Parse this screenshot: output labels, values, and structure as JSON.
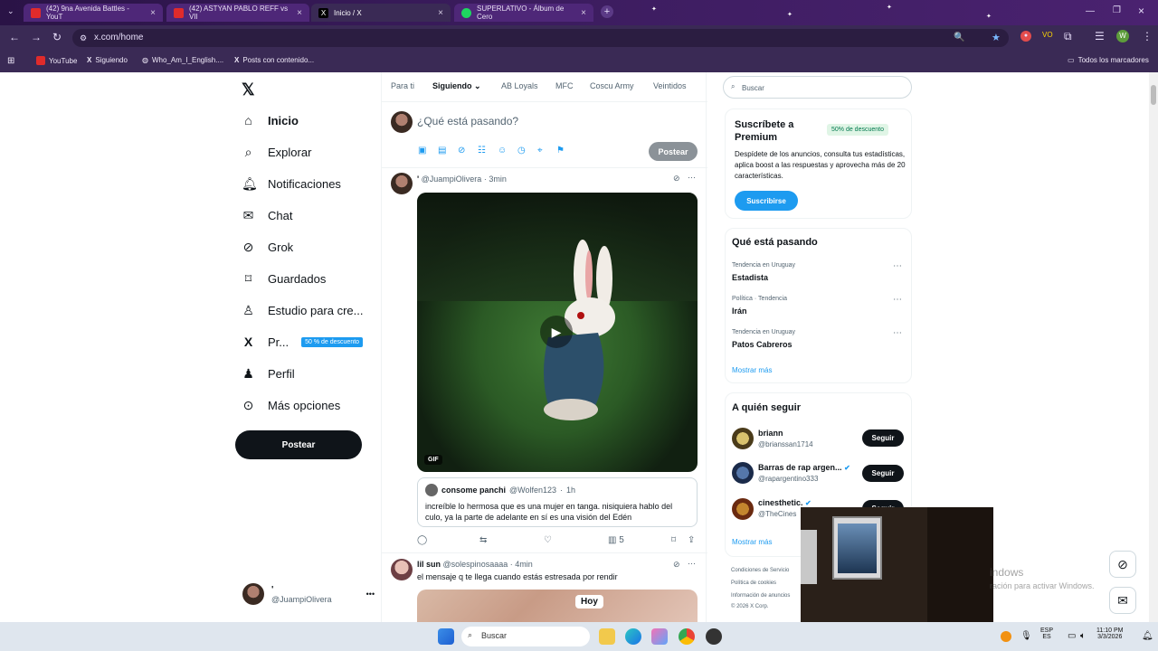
{
  "browser": {
    "tabs": [
      {
        "label": "(42) 9na Avenida Battles - YouT",
        "icon": "youtube-icon"
      },
      {
        "label": "(42) ASTYAN PABLO REFF vs VII",
        "icon": "youtube-icon"
      },
      {
        "label": "Inicio / X",
        "icon": "x-icon",
        "active": true
      },
      {
        "label": "SUPERLATIVO - Álbum de Cero",
        "icon": "spotify-icon"
      }
    ],
    "url": "x.com/home",
    "bookmarks": [
      {
        "label": "YouTube"
      },
      {
        "label": "Siguiendo"
      },
      {
        "label": "Who_Am_I_English...."
      },
      {
        "label": "Posts con contenido..."
      }
    ],
    "all_bookmarks": "Todos los marcadores"
  },
  "sidebar": {
    "items": [
      {
        "label": "Inicio",
        "icon": "home-icon"
      },
      {
        "label": "Explorar",
        "icon": "search-icon"
      },
      {
        "label": "Notificaciones",
        "icon": "bell-icon"
      },
      {
        "label": "Chat",
        "icon": "mail-icon"
      },
      {
        "label": "Grok",
        "icon": "grok-icon"
      },
      {
        "label": "Guardados",
        "icon": "bookmark-icon"
      },
      {
        "label": "Estudio para cre...",
        "icon": "studio-icon"
      },
      {
        "label": "Pr...",
        "icon": "x-icon"
      },
      {
        "label": "Perfil",
        "icon": "person-icon"
      },
      {
        "label": "Más opciones",
        "icon": "more-circle-icon"
      }
    ],
    "premium_badge": "50 % de descuento",
    "post_button": "Postear",
    "account": {
      "name": "'",
      "handle": "@JuampiOlivera",
      "more": "•••"
    }
  },
  "feed": {
    "tabs": [
      "Para ti",
      "Siguiendo",
      "AB Loyals",
      "MFC",
      "Coscu Army",
      "Veintidos"
    ],
    "composer_placeholder": "¿Qué está pasando?",
    "post_button": "Postear",
    "tweets": [
      {
        "name": "'",
        "handle": "@JuampiOlivera",
        "time": "3min",
        "media_badge": "GIF",
        "quote": {
          "name": "consome panchi",
          "handle": "@Wolfen123",
          "time": "1h",
          "text": "increíble lo hermosa que es una mujer en tanga. nisiquiera hablo del culo, ya la parte de adelante en sí es una visión del Edén"
        },
        "views": "5"
      },
      {
        "name": "lil sun",
        "handle": "@solespinosaaaa",
        "time": "4min",
        "text": "el mensaje q te llega cuando estás estresada por rendir",
        "media_label": "Hoy"
      }
    ]
  },
  "right": {
    "search_placeholder": "Buscar",
    "premium": {
      "title": "Suscríbete a Premium",
      "badge": "50% de descuento",
      "text": "Despídete de los anuncios, consulta tus estadísticas, aplica boost a las respuestas y aprovecha más de 20 características.",
      "button": "Suscribirse"
    },
    "trends": {
      "title": "Qué está pasando",
      "items": [
        {
          "meta": "Tendencia en Uruguay",
          "name": "Estadista"
        },
        {
          "meta": "Política · Tendencia",
          "name": "Irán"
        },
        {
          "meta": "Tendencia en Uruguay",
          "name": "Patos Cabreros"
        }
      ],
      "more": "Mostrar más"
    },
    "follow": {
      "title": "A quién seguir",
      "items": [
        {
          "name": "briann",
          "handle": "@brianssan1714",
          "button": "Seguir"
        },
        {
          "name": "Barras de rap argen...",
          "handle": "@rapargentino333",
          "button": "Seguir"
        },
        {
          "name": "cinesthetic.",
          "handle": "@TheCines",
          "button": "Seguir"
        }
      ],
      "more": "Mostrar más"
    },
    "footer": [
      "Condiciones de Servicio",
      "Política de cookies",
      "Información de anuncios",
      "© 2026 X Corp."
    ]
  },
  "overlay": {
    "activate_line1": "indows",
    "activate_line2": "ración para activar Windows."
  },
  "taskbar": {
    "search": "Buscar",
    "lang": "ESP",
    "lang2": "ES",
    "time": "11:10 PM",
    "date": "3/3/2026"
  },
  "colors": {
    "accent": "#1d9bf0",
    "browser_theme": "#3a2a55"
  }
}
